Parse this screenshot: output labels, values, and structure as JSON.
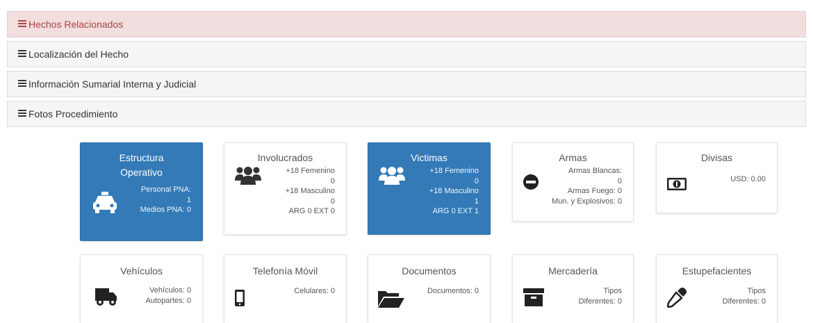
{
  "accordion": [
    {
      "label": "Hechos Relacionados",
      "active": true
    },
    {
      "label": "Localización del Hecho",
      "active": false
    },
    {
      "label": "Información Sumarial Interna y Judicial",
      "active": false
    },
    {
      "label": "Fotos Procedimiento",
      "active": false
    }
  ],
  "tiles": {
    "estructura": {
      "title_1": "Estructura",
      "title_2": "Operativo",
      "lines": [
        "Personal PNA:",
        "1",
        "Medios PNA: 0"
      ],
      "icon": "taxi-icon"
    },
    "involucrados": {
      "title": "Involucrados",
      "lines": [
        "+18 Femenino",
        "0",
        "+18 Masculino",
        "0",
        "ARG 0 EXT 0"
      ],
      "icon": "users-icon"
    },
    "victimas": {
      "title": "Victimas",
      "lines": [
        "+18 Femenino",
        "0",
        "+18 Masculino",
        "1",
        "ARG 0 EXT 1"
      ],
      "icon": "users-icon"
    },
    "armas": {
      "title": "Armas",
      "lines": [
        "Armas Blancas:",
        "0",
        "Armas Fuego: 0",
        "Mun. y Explosivos: 0"
      ],
      "icon": "minus-circle-icon"
    },
    "divisas": {
      "title": "Divisas",
      "lines": [
        "USD: 0.00"
      ],
      "icon": "money-icon"
    },
    "vehiculos": {
      "title": "Vehículos",
      "lines": [
        "Vehículos: 0",
        "Autopartes: 0"
      ],
      "icon": "truck-icon"
    },
    "telefonia": {
      "title": "Telefonía Móvil",
      "lines": [
        "Celulares: 0"
      ],
      "icon": "mobile-icon"
    },
    "documentos": {
      "title": "Documentos",
      "lines": [
        "Documentos: 0"
      ],
      "icon": "folder-open-icon"
    },
    "mercaderia": {
      "title": "Mercadería",
      "lines": [
        "Tipos",
        "Diferentes: 0"
      ],
      "icon": "archive-icon"
    },
    "estupefacientes": {
      "title": "Estupefacientes",
      "lines": [
        "Tipos",
        "Diferentes: 0"
      ],
      "icon": "eyedropper-icon"
    }
  },
  "colors": {
    "primary": "#337ab7",
    "danger_bg": "#f2dede",
    "danger_text": "#a94442",
    "panel_bg": "#f5f5f5"
  }
}
